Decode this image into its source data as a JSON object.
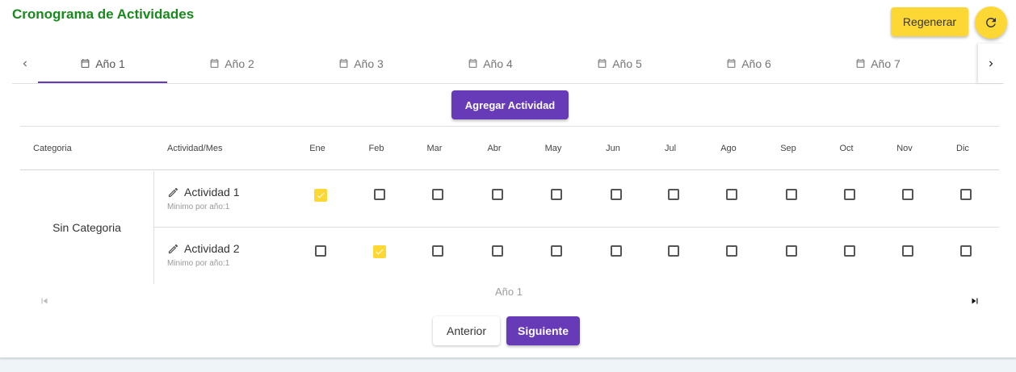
{
  "header": {
    "title": "Cronograma de Actividades",
    "regenerate_label": "Regenerar",
    "refresh_icon": "refresh-icon"
  },
  "tabs": [
    {
      "label": "Año 1",
      "active": true
    },
    {
      "label": "Año 2",
      "active": false
    },
    {
      "label": "Año 3",
      "active": false
    },
    {
      "label": "Año 4",
      "active": false
    },
    {
      "label": "Año 5",
      "active": false
    },
    {
      "label": "Año 6",
      "active": false
    },
    {
      "label": "Año 7",
      "active": false
    }
  ],
  "add_activity_label": "Agregar Actividad",
  "table": {
    "category_header": "Categoria",
    "activity_header": "Actividad/Mes",
    "months": [
      "Ene",
      "Feb",
      "Mar",
      "Abr",
      "May",
      "Jun",
      "Jul",
      "Ago",
      "Sep",
      "Oct",
      "Nov",
      "Dic"
    ],
    "category": "Sin Categoria",
    "rows": [
      {
        "name": "Actividad 1",
        "sub": "Minimo por año:1",
        "checked": [
          true,
          false,
          false,
          false,
          false,
          false,
          false,
          false,
          false,
          false,
          false,
          false
        ]
      },
      {
        "name": "Actividad 2",
        "sub": "Minimo por año:1",
        "checked": [
          false,
          true,
          false,
          false,
          false,
          false,
          false,
          false,
          false,
          false,
          false,
          false
        ]
      }
    ]
  },
  "pager": {
    "label": "Año 1"
  },
  "footer": {
    "prev_label": "Anterior",
    "next_label": "Siguiente"
  },
  "colors": {
    "accent": "#673ab7",
    "yellow": "#fdd835",
    "title_green": "#178a1b"
  }
}
